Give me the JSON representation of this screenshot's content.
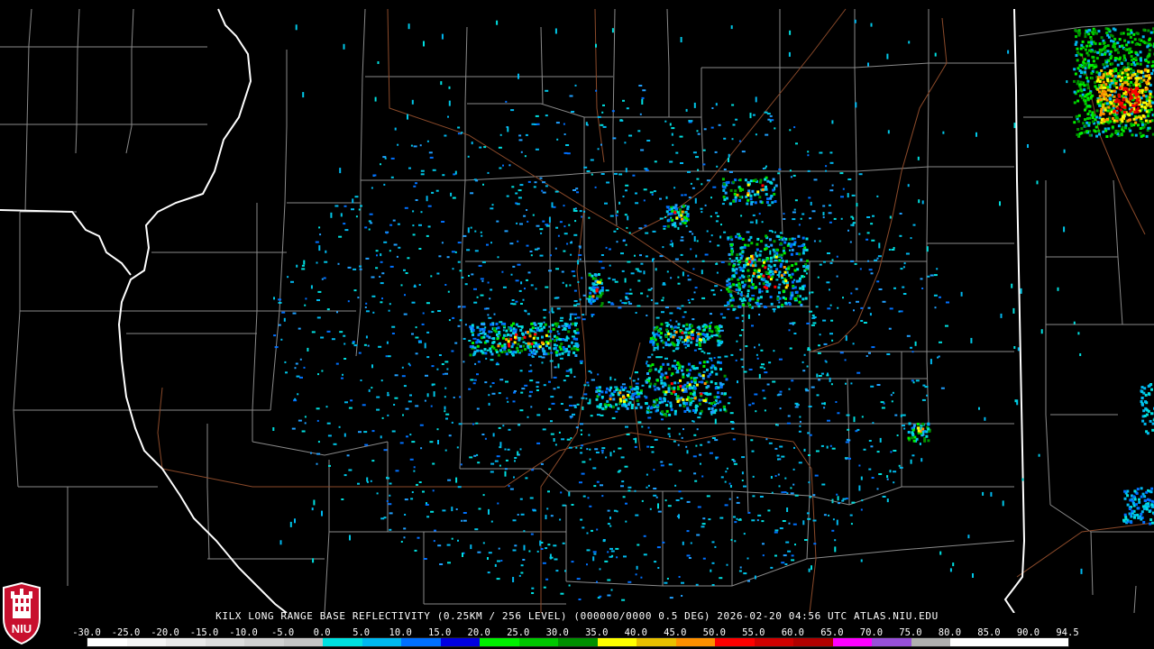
{
  "caption": "KILX LONG RANGE BASE REFLECTIVITY (0.25KM / 256 LEVEL) (000000/0000 0.5 DEG) 2026-02-20 04:56 UTC  ATLAS.NIU.EDU",
  "logo_text": "NIU",
  "colors": {
    "background": "#000000",
    "county_lines": "#8a8a8a",
    "state_lines": "#ffffff",
    "roads": "#8b4a2a"
  },
  "icons": [
    "niu-logo-icon"
  ],
  "scale": {
    "labels": [
      "-30.0",
      "-25.0",
      "-20.0",
      "-15.0",
      "-10.0",
      "-5.0",
      "0.0",
      "5.0",
      "10.0",
      "15.0",
      "20.0",
      "25.0",
      "30.0",
      "35.0",
      "40.0",
      "45.0",
      "50.0",
      "55.0",
      "60.0",
      "65.0",
      "70.0",
      "75.0",
      "80.0",
      "85.0",
      "90.0",
      "94.5"
    ],
    "colors": [
      "#ffffff",
      "#f4f4f4",
      "#e8e8e8",
      "#dcdcdc",
      "#d0d0d0",
      "#c4c4c4",
      "#00e0e0",
      "#00b8f0",
      "#0070ff",
      "#0000e0",
      "#00f000",
      "#00c800",
      "#009000",
      "#ffff00",
      "#e8c000",
      "#ff9000",
      "#ff0000",
      "#d00000",
      "#b00000",
      "#ff00ff",
      "#9850d8",
      "#b0b0b0",
      "#ffffff",
      "#ffffff",
      "#ffffff"
    ]
  }
}
